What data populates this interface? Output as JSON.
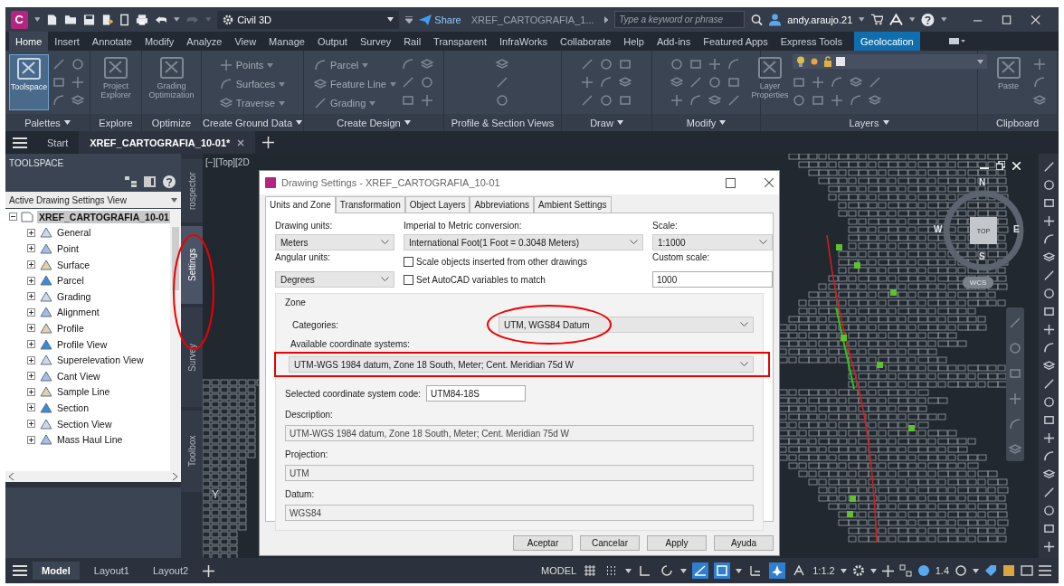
{
  "title_bar": {
    "logo": "C",
    "workspace": "Civil 3D",
    "share": "Share",
    "document": "XREF_CARTOGRAFIA_1...",
    "search": {
      "placeholder": "Type a keyword or phrase"
    },
    "user": "andy.araujo.21"
  },
  "ribbon": {
    "tabs": [
      {
        "label": "Home",
        "selected": true,
        "kind": "normal"
      },
      {
        "label": "Insert",
        "selected": false,
        "kind": "normal"
      },
      {
        "label": "Annotate",
        "selected": false,
        "kind": "normal"
      },
      {
        "label": "Modify",
        "selected": false,
        "kind": "normal"
      },
      {
        "label": "Analyze",
        "selected": false,
        "kind": "normal"
      },
      {
        "label": "View",
        "selected": false,
        "kind": "normal"
      },
      {
        "label": "Manage",
        "selected": false,
        "kind": "normal"
      },
      {
        "label": "Output",
        "selected": false,
        "kind": "normal"
      },
      {
        "label": "Survey",
        "selected": false,
        "kind": "normal"
      },
      {
        "label": "Rail",
        "selected": false,
        "kind": "normal"
      },
      {
        "label": "Transparent",
        "selected": false,
        "kind": "normal"
      },
      {
        "label": "InfraWorks",
        "selected": false,
        "kind": "normal"
      },
      {
        "label": "Collaborate",
        "selected": false,
        "kind": "normal"
      },
      {
        "label": "Help",
        "selected": false,
        "kind": "normal"
      },
      {
        "label": "Add-ins",
        "selected": false,
        "kind": "normal"
      },
      {
        "label": "Featured Apps",
        "selected": false,
        "kind": "normal"
      },
      {
        "label": "Express Tools",
        "selected": false,
        "kind": "normal"
      },
      {
        "label": "Geolocation",
        "selected": false,
        "kind": "contextual"
      }
    ],
    "panels": [
      {
        "title": "Palettes",
        "dropdown": true,
        "buttons": [
          {
            "label": "Toolspace",
            "kind": "large",
            "active": true
          }
        ]
      },
      {
        "title": "Explore",
        "dropdown": false,
        "buttons": [
          {
            "label": "Project Explorer",
            "kind": "large",
            "active": false
          }
        ]
      },
      {
        "title": "Optimize",
        "dropdown": false,
        "buttons": [
          {
            "label": "Grading Optimization",
            "kind": "large",
            "active": false
          }
        ]
      },
      {
        "title": "Create Ground Data",
        "dropdown": true,
        "buttons": [
          {
            "label": "Points",
            "kind": "small",
            "active": false
          },
          {
            "label": "Surfaces",
            "kind": "small",
            "active": false
          },
          {
            "label": "Traverse",
            "kind": "small",
            "active": false
          }
        ]
      },
      {
        "title": "Create Design",
        "dropdown": true,
        "buttons": [
          {
            "label": "Parcel",
            "kind": "small",
            "active": false
          },
          {
            "label": "Feature Line",
            "kind": "small",
            "active": false
          },
          {
            "label": "Grading",
            "kind": "small",
            "active": false
          }
        ]
      },
      {
        "title": "Profile & Section Views",
        "dropdown": false
      },
      {
        "title": "Draw",
        "dropdown": true
      },
      {
        "title": "Modify",
        "dropdown": true
      },
      {
        "title": "Layers",
        "dropdown": true,
        "buttons": [
          {
            "label": "Layer Properties",
            "kind": "large",
            "active": false
          }
        ]
      },
      {
        "title": "Clipboard",
        "dropdown": false,
        "buttons": [
          {
            "label": "Paste",
            "kind": "large",
            "active": false
          }
        ]
      }
    ]
  },
  "doc_tabs": [
    {
      "label": "Start",
      "selected": false,
      "closable": false
    },
    {
      "label": "XREF_CARTOGRAFIA_10-01*",
      "selected": true,
      "closable": true
    }
  ],
  "toolspace": {
    "title": "TOOLSPACE",
    "view": "Active Drawing Settings View",
    "tree": {
      "label": "XREF_CARTOGRAFIA_10-01",
      "selected": true,
      "expanded": true,
      "children": [
        {
          "label": "General",
          "selected": false,
          "expanded": false
        },
        {
          "label": "Point",
          "selected": false,
          "expanded": false
        },
        {
          "label": "Surface",
          "selected": false,
          "expanded": false
        },
        {
          "label": "Parcel",
          "selected": false,
          "expanded": false
        },
        {
          "label": "Grading",
          "selected": false,
          "expanded": false
        },
        {
          "label": "Alignment",
          "selected": false,
          "expanded": false
        },
        {
          "label": "Profile",
          "selected": false,
          "expanded": false
        },
        {
          "label": "Profile View",
          "selected": false,
          "expanded": false
        },
        {
          "label": "Superelevation View",
          "selected": false,
          "expanded": false
        },
        {
          "label": "Cant View",
          "selected": false,
          "expanded": false
        },
        {
          "label": "Sample Line",
          "selected": false,
          "expanded": false
        },
        {
          "label": "Section",
          "selected": false,
          "expanded": false
        },
        {
          "label": "Section View",
          "selected": false,
          "expanded": false
        },
        {
          "label": "Mass Haul Line",
          "selected": false,
          "expanded": false
        }
      ]
    },
    "side_tabs": [
      {
        "label": "rospector",
        "selected": false
      },
      {
        "label": "Settings",
        "selected": true
      },
      {
        "label": "Survey",
        "selected": false
      },
      {
        "label": "Toolbox",
        "selected": false
      }
    ]
  },
  "viewport": {
    "label": "[−][Top][2D",
    "axis": "Y",
    "viewcube": {
      "north": "N",
      "south": "S",
      "east": "E",
      "west": "W",
      "face": "TOP",
      "ucs": "WCS"
    }
  },
  "dialog": {
    "title": "Drawing Settings - XREF_CARTOGRAFIA_10-01",
    "tabs": [
      {
        "label": "Units and Zone",
        "selected": true
      },
      {
        "label": "Transformation",
        "selected": false
      },
      {
        "label": "Object Layers",
        "selected": false
      },
      {
        "label": "Abbreviations",
        "selected": false
      },
      {
        "label": "Ambient Settings",
        "selected": false
      }
    ],
    "drawing_units": {
      "label": "Drawing units:",
      "value": "Meters"
    },
    "conversion": {
      "label": "Imperial to Metric conversion:",
      "value": "International Foot(1 Foot = 0.3048 Meters)"
    },
    "scale": {
      "label": "Scale:",
      "value": "1:1000"
    },
    "angular_units": {
      "label": "Angular units:",
      "value": "Degrees"
    },
    "checkboxes": [
      {
        "label": "Scale objects inserted from other drawings",
        "checked": false
      },
      {
        "label": "Set AutoCAD variables to match",
        "checked": false
      }
    ],
    "custom_scale": {
      "label": "Custom scale:",
      "value": "1000"
    },
    "zone": {
      "title": "Zone",
      "categories": {
        "label": "Categories:",
        "value": "UTM, WGS84 Datum"
      },
      "available": {
        "label": "Available coordinate systems:",
        "value": "UTM-WGS 1984 datum, Zone 18 South, Meter; Cent. Meridian 75d W"
      },
      "code": {
        "label": "Selected coordinate system code:",
        "value": "UTM84-18S"
      },
      "description": {
        "label": "Description:",
        "value": "UTM-WGS 1984 datum, Zone 18 South, Meter; Cent. Meridian 75d W"
      },
      "projection": {
        "label": "Projection:",
        "value": "UTM"
      },
      "datum": {
        "label": "Datum:",
        "value": "WGS84"
      }
    },
    "buttons": [
      "Aceptar",
      "Cancelar",
      "Apply",
      "Ayuda"
    ]
  },
  "status_bar": {
    "layout_tabs": [
      {
        "label": "Model",
        "selected": true
      },
      {
        "label": "Layout1",
        "selected": false
      },
      {
        "label": "Layout2",
        "selected": false
      }
    ],
    "model": "MODEL",
    "annotation_scale": "1:1.2",
    "lineweight": "1.4",
    "toggles": [
      {
        "on": false
      },
      {
        "on": false
      },
      {
        "on": false
      },
      {
        "on": false
      },
      {
        "on": true
      },
      {
        "on": true
      },
      {
        "on": false
      },
      {
        "on": true
      },
      {
        "on": false
      }
    ]
  }
}
